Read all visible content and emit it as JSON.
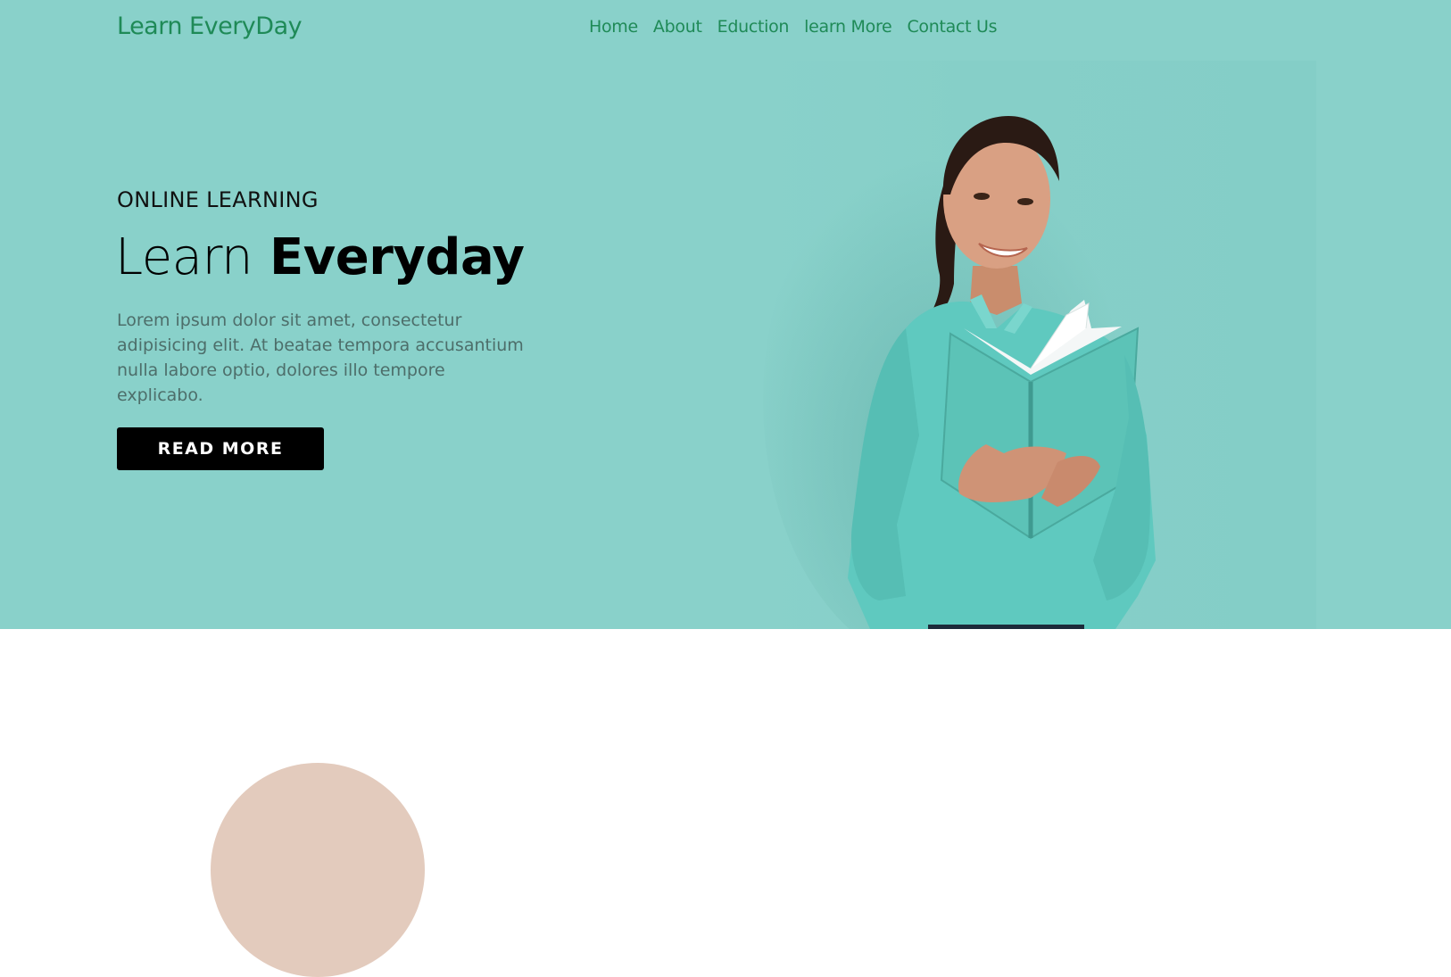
{
  "nav": {
    "brand": "Learn EveryDay",
    "links": [
      "Home",
      "About",
      "Eduction",
      "learn More",
      "Contact Us"
    ]
  },
  "hero": {
    "eyebrow": "ONLINE LEARNING",
    "headline_light": "Learn",
    "headline_bold": "Everyday",
    "body": "Lorem ipsum dolor sit amet, consectetur adipisicing elit. At beatae tempora accusantium nulla labore optio, dolores illo tempore explicabo.",
    "cta_label": "READ MORE"
  },
  "colors": {
    "hero_background": "#89d1ca",
    "brand_green": "#1f8a57",
    "button_background": "#000000",
    "shirt_teal": "#5fc9bf",
    "book_teal": "#5cc3b7"
  }
}
